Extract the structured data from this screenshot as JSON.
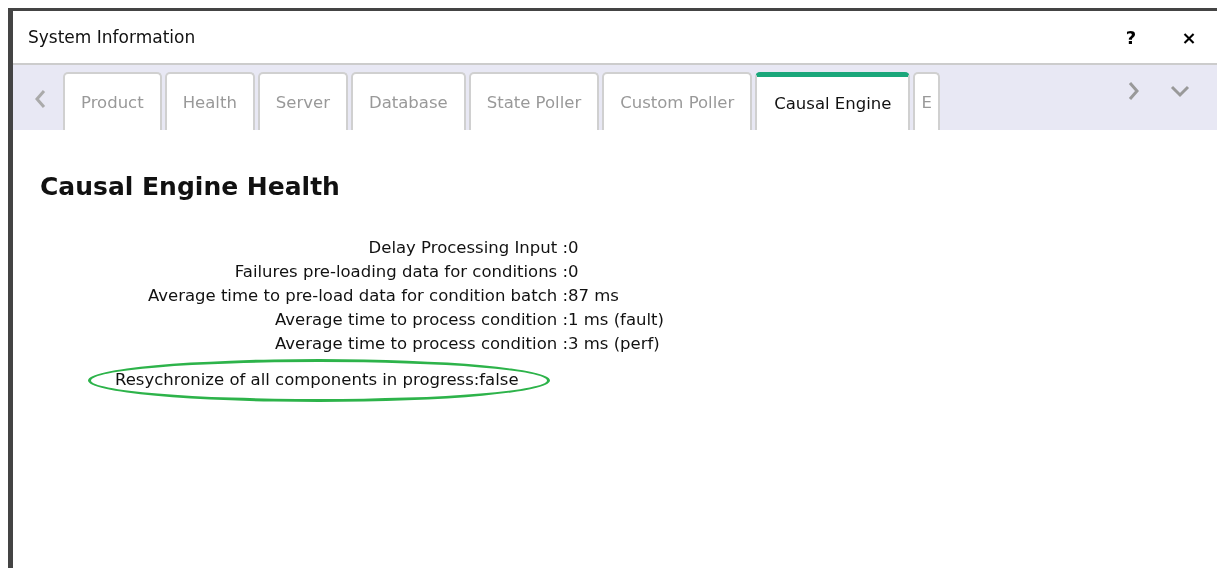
{
  "window": {
    "title": "System Information",
    "help": "?",
    "close": "×"
  },
  "tabs": [
    {
      "label": "Product",
      "selected": false
    },
    {
      "label": "Health",
      "selected": false
    },
    {
      "label": "Server",
      "selected": false
    },
    {
      "label": "Database",
      "selected": false
    },
    {
      "label": "State Poller",
      "selected": false
    },
    {
      "label": "Custom Poller",
      "selected": false
    },
    {
      "label": "Causal Engine",
      "selected": true
    },
    {
      "label": "E",
      "selected": false
    }
  ],
  "heading": "Causal Engine Health",
  "metrics": [
    {
      "label": "Delay Processing Input :",
      "value": "0"
    },
    {
      "label": "Failures pre-loading data for conditions :",
      "value": "0"
    },
    {
      "label": "Average time to pre-load data for condition batch :",
      "value": "87 ms"
    },
    {
      "label": "Average time to process condition :",
      "value": "1 ms (fault)"
    },
    {
      "label": "Average time to process condition :",
      "value": "3 ms (perf)"
    }
  ],
  "resync": "Resychronize of all components in progress:false"
}
